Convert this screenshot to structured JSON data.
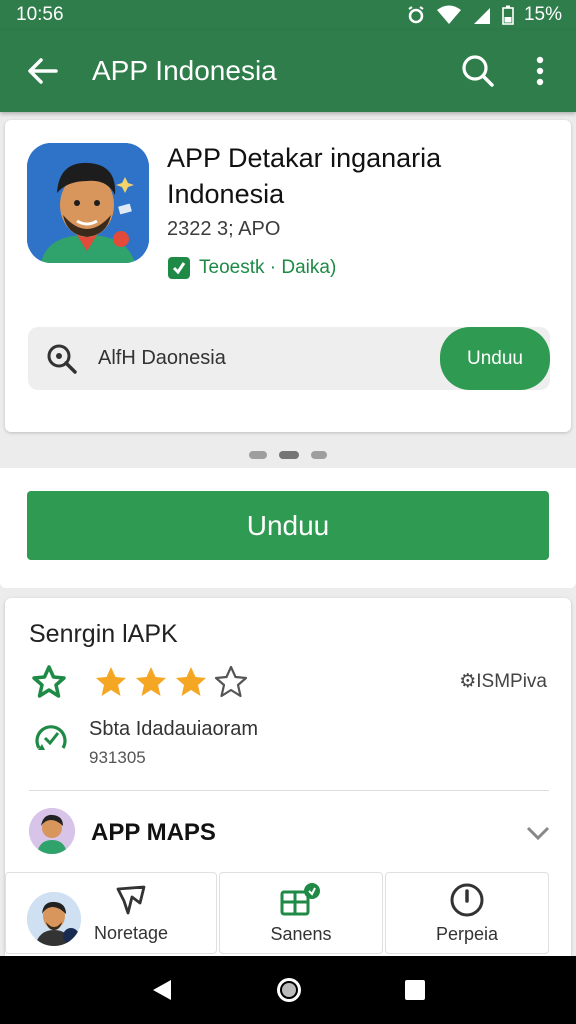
{
  "status": {
    "time": "10:56",
    "battery": "15%"
  },
  "appbar": {
    "title": "APP Indonesia",
    "back_icon": "arrow-left-icon",
    "search_icon": "search-icon",
    "menu_icon": "more-vert-icon"
  },
  "app": {
    "name": "APP Detakar inganaria Indonesia",
    "meta": "2322 3; APO",
    "developer": "Teoestk · Daika)"
  },
  "search": {
    "text": "AlfH Daonesia",
    "button": "Unduu"
  },
  "main_button": "Unduu",
  "rating_section": {
    "title": "Senrgin lAPK",
    "rating": 3,
    "max_rating": 4,
    "meta": "⚙ISMPiva",
    "stat_line1": "Sbta Idadauiaoram",
    "stat_line2": "931305"
  },
  "maps": {
    "label": "APP MAPS"
  },
  "bottom_nav": [
    {
      "label": "Noretage",
      "icon": "map-pin-icon"
    },
    {
      "label": "Sanens",
      "icon": "gallery-icon"
    },
    {
      "label": "Perpeia",
      "icon": "clock-icon"
    }
  ],
  "colors": {
    "primary": "#2e7d4a",
    "accent": "#2f9a52",
    "star": "#f5a623"
  }
}
